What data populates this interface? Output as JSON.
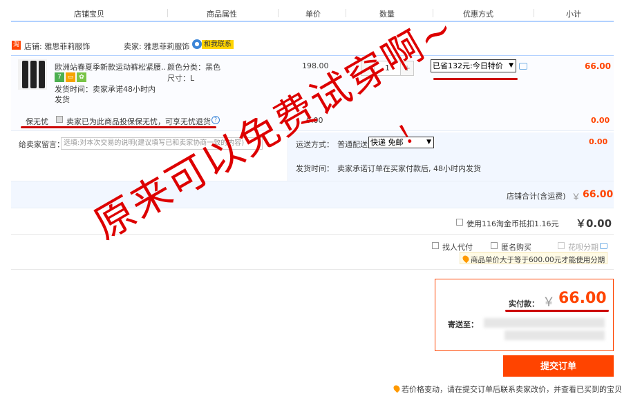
{
  "header": {
    "col_item": "店铺宝贝",
    "col_attr": "商品属性",
    "col_price": "单价",
    "col_qty": "数量",
    "col_promo": "优惠方式",
    "col_subtotal": "小计"
  },
  "shop": {
    "tao_badge": "淘",
    "shop_label": "店铺: 雅思菲莉服饰",
    "seller_label": "卖家: 雅思菲莉服饰",
    "contact_label": "和我联系"
  },
  "item": {
    "title": "欧洲站春夏季新款运动裤松紧腰…",
    "badge1": "7",
    "ship_promise": "发货时间：卖家承诺48小时内发货",
    "color_label": "颜色分类：黑色",
    "size_label": "尺寸：L",
    "price": "198.00",
    "qty_minus": "-",
    "qty_value": "1",
    "qty_plus": "+",
    "promo_selected": "已省132元:今日特价",
    "subtotal": "66.00"
  },
  "insurance": {
    "label": "保无忧",
    "desc": "卖家已为此商品投保保无忧，可享无忧退货",
    "help": "?",
    "price": "0.00",
    "subtotal": "0.00"
  },
  "message": {
    "label": "给卖家留言：",
    "placeholder": "选填:对本次交易的说明(建议填写已和卖家协商一致的内容)"
  },
  "shipping": {
    "label": "运送方式：",
    "method": "普通配送",
    "select_value": "快递 免邮",
    "cost": "0.00",
    "time_label": "发货时间：",
    "time_text": "卖家承诺订单在买家付款后, 48小时内发货"
  },
  "shop_total": {
    "label": "店铺合计(含运费)",
    "currency": "￥",
    "value": "66.00"
  },
  "coins": {
    "label": "使用116淘金币抵扣1.16元",
    "value": "￥0.00"
  },
  "options": {
    "proxy": "找人代付",
    "anonymous": "匿名购买",
    "huabei": "花呗分期",
    "huabei_note": "商品单价大于等于600.00元才能使用分期"
  },
  "payment": {
    "label": "实付款：",
    "currency": "￥",
    "value": "66.00",
    "ship_to_label": "寄送至：",
    "submit": "提交订单"
  },
  "footer_note": "若价格变动，请在提交订单后联系卖家改价，并查看已买到的宝贝",
  "overlay": {
    "main": "原来可以免费试穿啊~",
    "exclaim": "！"
  }
}
